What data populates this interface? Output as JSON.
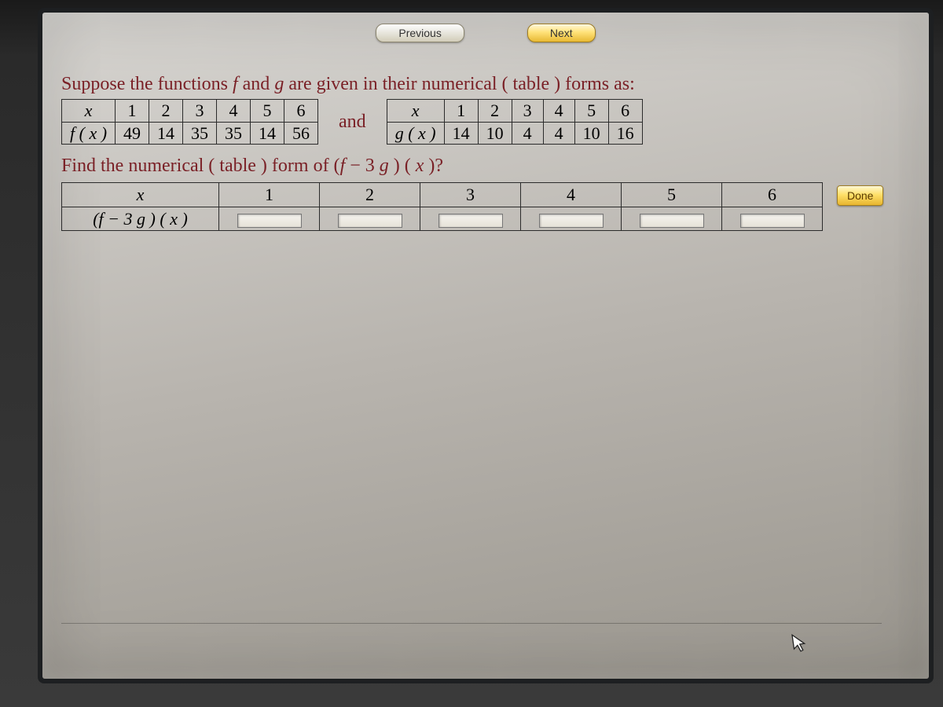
{
  "nav": {
    "previous": "Previous",
    "next": "Next"
  },
  "intro": {
    "prefix": "Suppose the functions ",
    "f": "f",
    "mid1": " and ",
    "g": "g",
    "suffix": "  are given in their numerical ( table ) forms as:"
  },
  "table_f": {
    "var": "x",
    "label": "f ( x )",
    "x": [
      "1",
      "2",
      "3",
      "4",
      "5",
      "6"
    ],
    "vals": [
      "49",
      "14",
      "35",
      "35",
      "14",
      "56"
    ]
  },
  "between": "and",
  "table_g": {
    "var": "x",
    "label": "g ( x )",
    "x": [
      "1",
      "2",
      "3",
      "4",
      "5",
      "6"
    ],
    "vals": [
      "14",
      "10",
      "4",
      "4",
      "10",
      "16"
    ]
  },
  "question": {
    "prefix": "Find the numerical ( table ) form of  (",
    "f": "f",
    "mid": " − 3 ",
    "g": "g",
    "close": " ) ( ",
    "x": "x",
    "suffix": " )?"
  },
  "answer": {
    "var": "x",
    "label_open": "(",
    "label_f": "f",
    "label_mid": " − 3 ",
    "label_g": "g",
    "label_close": " ) ( ",
    "label_x": "x",
    "label_end": " )",
    "cols": [
      "1",
      "2",
      "3",
      "4",
      "5",
      "6"
    ],
    "inputs": [
      "",
      "",
      "",
      "",
      "",
      ""
    ]
  },
  "done": "Done",
  "icons": {
    "cursor": "cursor-icon"
  }
}
